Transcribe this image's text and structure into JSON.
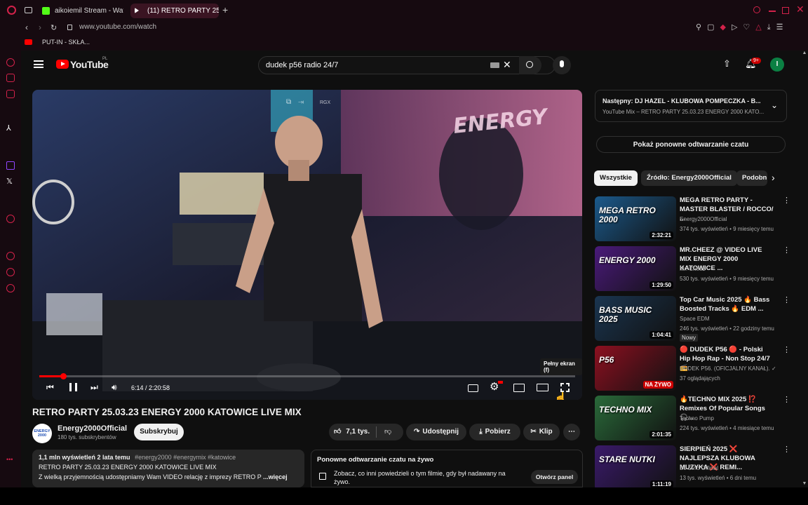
{
  "browser": {
    "tabs": [
      {
        "label": "aikoiemil Stream - Watch"
      },
      {
        "label": "(11) RETRO PARTY 25"
      }
    ],
    "url": "www.youtube.com/watch",
    "bookmark": "PUT-IN - SKŁA..."
  },
  "header": {
    "logo": "YouTube",
    "region": "PL",
    "search_value": "dudek p56 radio 24/7",
    "notif_count": "9+",
    "avatar_letter": "I"
  },
  "player": {
    "time": "6:14 / 2:20:58",
    "fullscreen_tip": "Pełny ekran (f)",
    "overlay_label": "RGX",
    "stage_text": "ENERGY",
    "progress": 0.044
  },
  "video": {
    "title": "RETRO PARTY 25.03.23 ENERGY 2000 KATOWICE LIVE MIX",
    "channel": "Energy2000Official",
    "subs": "180 tys. subskrybentów",
    "subscribe_label": "Subskrybuj",
    "likes": "7,1 tys.",
    "share_label": "Udostępnij",
    "download_label": "Pobierz",
    "clip_label": "Klip",
    "channel_logo": "ENERGY 2000"
  },
  "description": {
    "stats": "1,1 mln wyświetleń  2 lata temu",
    "tags": "#energy2000 #energymix #katowice",
    "line1": "RETRO PARTY 25.03.23 ENERGY 2000 KATOWICE LIVE MIX",
    "line2": "Z wielką przyjemnością udostępniamy Wam VIDEO relację z imprezy RETRO P",
    "more": "...więcej"
  },
  "chat_replay": {
    "title": "Ponowne odtwarzanie czatu na żywo",
    "text": "Zobacz, co inni powiedzieli o tym filmie, gdy był nadawany na żywo.",
    "button": "Otwórz panel"
  },
  "sidebar": {
    "next_label": "Następny: DJ HAZEL - KLUBOWA POMPECZKA - B...",
    "next_sub": "YouTube Mix – RETRO PARTY 25.03.23 ENERGY 2000 KATO...",
    "show_chat": "Pokaż ponowne odtwarzanie czatu",
    "chips": [
      "Wszystkie",
      "Źródło: Energy2000Official",
      "Podobn"
    ],
    "items": [
      {
        "title": "MEGA RETRO PARTY - MASTER BLASTER / ROCCO/ ...",
        "channel": "Energy2000Official",
        "meta": "374 tys. wyświetleń • 9 miesięcy temu",
        "duration": "2:32:21",
        "thumb_text": "MEGA RETRO 2000",
        "bg": "#1b5a8c"
      },
      {
        "title": "MR.CHEEZ @ VIDEO LIVE MIX ENERGY 2000 KATOWICE ...",
        "channel": "Mr. Cheez",
        "meta": "530 tys. wyświetleń • 9 miesięcy temu",
        "duration": "1:29:50",
        "thumb_text": "ENERGY 2000",
        "bg": "#4a1a7a"
      },
      {
        "title": "Top Car Music 2025 🔥 Bass Boosted Tracks 🔥 EDM ...",
        "channel": "Space EDM",
        "meta": "246 tys. wyświetleń • 22 godziny temu",
        "duration": "1:04:41",
        "badge": "Nowy",
        "thumb_text": "BASS MUSIC 2025",
        "bg": "#1a3550"
      },
      {
        "title": "🔴 DUDEK P56 🔴 - Polski Hip Hop Rap - Non Stop 24/7 📻",
        "channel": "DUDEK P56. (OFICJALNY KANAŁ). ✓",
        "meta": "37 oglądających",
        "live": "NA ŻYWO",
        "thumb_text": "P56",
        "bg": "#8c1020"
      },
      {
        "title": "🔥TECHNO MIX 2025 ⁉️ Remixes Of Popular Songs 🎧...",
        "channel": "Techno Pump",
        "meta": "224 tys. wyświetleń • 4 miesiące temu",
        "duration": "2:01:35",
        "thumb_text": "TECHNO MIX",
        "bg": "#2a6a3a"
      },
      {
        "title": "SIERPIEŃ 2025 ❌ NAJLEPSZA KLUBOWA MUZYKA ❌ REMI...",
        "channel": "DJ Dino Official",
        "meta": "13 tys. wyświetleń • 6 dni temu",
        "duration": "1:11:19",
        "thumb_text": "STARE NUTKI",
        "bg": "#3a1a6a"
      }
    ]
  },
  "colors": {
    "accent_red": "#ff0000",
    "opera_red": "#d3224a",
    "bg": "#0f0f0f"
  }
}
